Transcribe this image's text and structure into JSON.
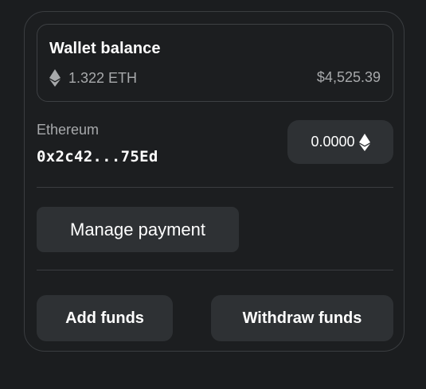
{
  "wallet": {
    "title": "Wallet balance",
    "eth_amount": "1.322 ETH",
    "usd_value": "$4,525.39",
    "icon": "ethereum-icon"
  },
  "account": {
    "network": "Ethereum",
    "address": "0x2c42...75Ed",
    "amount": "0.0000",
    "icon": "ethereum-icon"
  },
  "actions": {
    "manage_payment": "Manage payment",
    "add_funds": "Add funds",
    "withdraw_funds": "Withdraw funds"
  },
  "colors": {
    "background": "#1b1d1f",
    "button_background": "#2e3134",
    "border": "#3a3d40",
    "muted_text": "#a7a9ab",
    "primary_text": "#ffffff"
  }
}
